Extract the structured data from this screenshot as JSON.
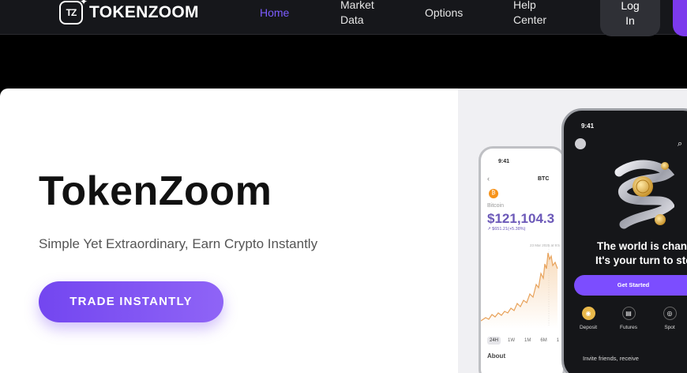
{
  "brand": {
    "logo_mark": "TZ",
    "name": "TOKENZOOM"
  },
  "nav": {
    "links": [
      {
        "label": "Home",
        "active": true
      },
      {
        "label": "Market\nData",
        "active": false
      },
      {
        "label": "Options",
        "active": false
      },
      {
        "label": "Help\nCenter",
        "active": false
      }
    ],
    "login_label": "Log\nIn"
  },
  "hero": {
    "title": "TokenZoom",
    "subtitle": "Simple Yet Extraordinary, Earn Crypto Instantly",
    "cta_label": "TRADE INSTANTLY"
  },
  "phone_back": {
    "time": "9:41",
    "pair": "BTC",
    "coin_name": "Bitcoin",
    "price": "$121,104.3",
    "change": "↗ $651.21(+5.38%)",
    "chart_date": "23 Mar 2025 at 9:5",
    "ranges": [
      "24H",
      "1W",
      "1M",
      "6M",
      "1"
    ],
    "selected_range": "24H",
    "about_label": "About"
  },
  "phone_front": {
    "time": "9:41",
    "headline_1": "The world is changi",
    "headline_2": "It's your turn to step",
    "cta_label": "Get Started",
    "actions": [
      {
        "label": "Deposit",
        "icon": "coin-icon"
      },
      {
        "label": "Futures",
        "icon": "futures-icon"
      },
      {
        "label": "Spot",
        "icon": "spot-icon"
      }
    ],
    "invite_text": "Invite friends, receive"
  },
  "colors": {
    "accent": "#7c5cff",
    "cta_start": "#7346f0",
    "cta_end": "#8f64f6",
    "nav_bg": "#16171b"
  }
}
